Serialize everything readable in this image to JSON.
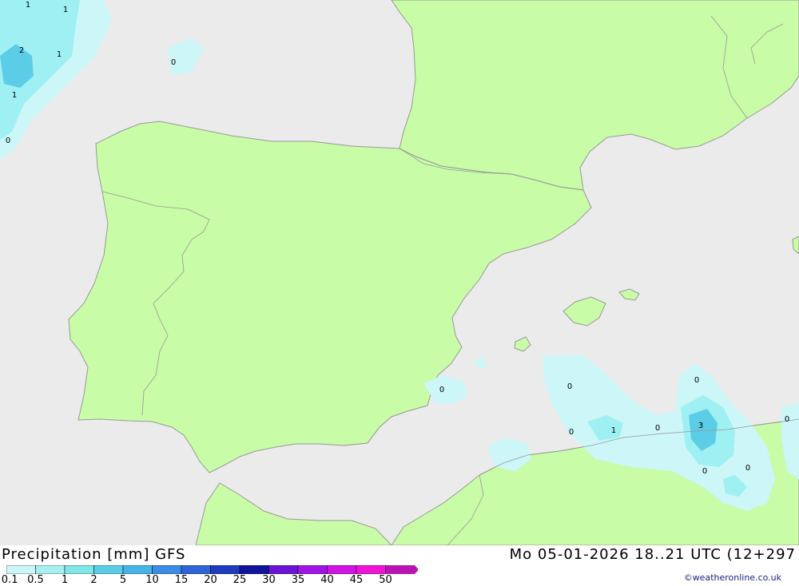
{
  "map": {
    "contour_labels": [
      {
        "text": "1",
        "id": "l1"
      },
      {
        "text": "1",
        "id": "l2"
      },
      {
        "text": "2",
        "id": "l3"
      },
      {
        "text": "1",
        "id": "l4"
      },
      {
        "text": "1",
        "id": "l5"
      },
      {
        "text": "0",
        "id": "l6"
      },
      {
        "text": "0",
        "id": "l7"
      },
      {
        "text": "0",
        "id": "l8"
      },
      {
        "text": "0",
        "id": "l9"
      },
      {
        "text": "0",
        "id": "l10"
      },
      {
        "text": "1",
        "id": "l11"
      },
      {
        "text": "0",
        "id": "l12"
      },
      {
        "text": "0",
        "id": "l13"
      },
      {
        "text": "3",
        "id": "l14"
      },
      {
        "text": "0",
        "id": "l15"
      },
      {
        "text": "0",
        "id": "l16"
      },
      {
        "text": "0",
        "id": "l17"
      }
    ],
    "colors": {
      "sea": "#ebebeb",
      "land": "#c8fca6",
      "coast": "#999999",
      "precip_light": "#ccf6f8",
      "precip_mid": "#9ef0f2",
      "precip_heavy": "#5ccde6"
    }
  },
  "footer": {
    "title": "Precipitation [mm] GFS",
    "datetime": "Mo 05-01-2026 18..21 UTC (12+297",
    "credit": "©weatheronline.co.uk"
  },
  "legend": {
    "labels": [
      "0.1",
      "0.5",
      "1",
      "2",
      "5",
      "10",
      "15",
      "20",
      "25",
      "30",
      "35",
      "40",
      "45",
      "50"
    ],
    "colors": [
      "#ccf6f8",
      "#a8f0f0",
      "#80e6e6",
      "#5ccde6",
      "#45b4e6",
      "#3c8ce6",
      "#2e64d6",
      "#1e3cbe",
      "#10149c",
      "#6a14d6",
      "#a014e6",
      "#d014e6",
      "#f014d6",
      "#b814b4"
    ]
  }
}
